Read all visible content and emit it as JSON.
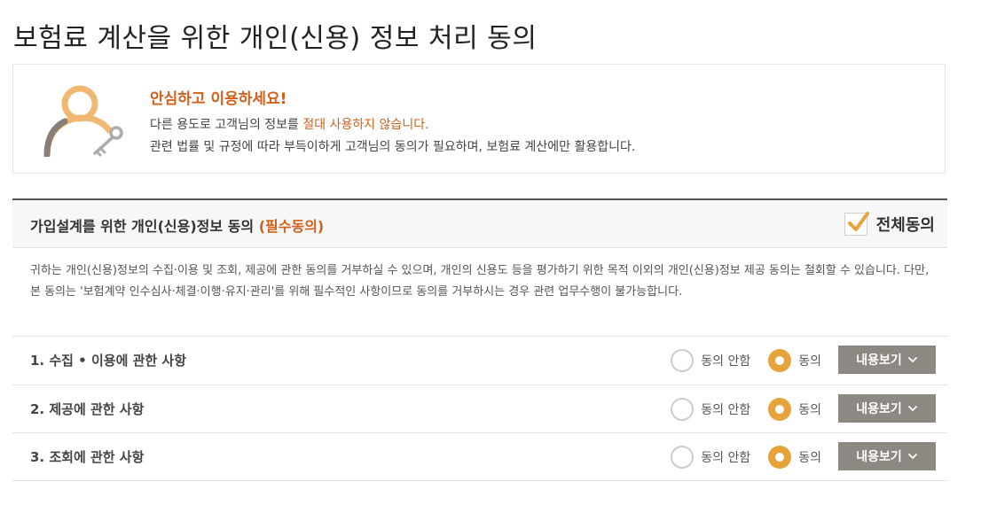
{
  "page": {
    "title": "보험료 계산을 위한 개인(신용) 정보 처리 동의"
  },
  "notice": {
    "illustration_icon": "person-key-icon",
    "heading": "안심하고 이용하세요!",
    "line1_prefix": "다른 용도로 고객님의 정보를 ",
    "line1_highlight": "절대 사용하지 않습니다.",
    "line2": "관련 법률 및 규정에 따라 부득이하게 고객님의 동의가 필요하며, 보험료 계산에만 활용합니다."
  },
  "consent": {
    "title": "가입설계를 위한 개인(신용)정보 동의",
    "required_label": "(필수동의)",
    "all_agree_label": "전체동의",
    "all_agree_checked": true,
    "description": "귀하는 개인(신용)정보의 수집·이용 및 조회, 제공에 관한 동의를 거부하실 수 있으며, 개인의 신용도 등을 평가하기 위한 목적 이외의 개인(신용)정보 제공 동의는 철회할 수 있습니다. 다만, 본 동의는 '보험계약 인수심사·체결·이행·유지·관리'를 위해 필수적인 사항이므로 동의를 거부하시는 경우 관련 업무수행이 불가능합니다.",
    "items": [
      {
        "label": "1. 수집 • 이용에 관한 사항",
        "disagree_label": "동의 안함",
        "agree_label": "동의",
        "selected": "agree",
        "view_label": "내용보기"
      },
      {
        "label": "2. 제공에 관한 사항",
        "disagree_label": "동의 안함",
        "agree_label": "동의",
        "selected": "agree",
        "view_label": "내용보기"
      },
      {
        "label": "3. 조회에 관한 사항",
        "disagree_label": "동의 안함",
        "agree_label": "동의",
        "selected": "agree",
        "view_label": "내용보기"
      }
    ]
  },
  "colors": {
    "accent_orange": "#d2601a",
    "radio_selected": "#e6a33a",
    "button_gray": "#8e8883"
  }
}
